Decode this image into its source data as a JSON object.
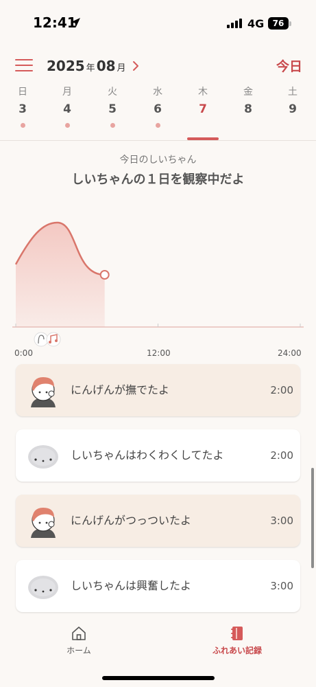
{
  "status_bar": {
    "time": "12:41",
    "network": "4G",
    "battery": "76"
  },
  "header": {
    "year": "2025",
    "year_unit": "年",
    "month": "08",
    "month_unit": "月",
    "today_label": "今日"
  },
  "week": [
    {
      "weekday": "日",
      "date": "3",
      "has_record": true,
      "selected": false
    },
    {
      "weekday": "月",
      "date": "4",
      "has_record": true,
      "selected": false
    },
    {
      "weekday": "火",
      "date": "5",
      "has_record": true,
      "selected": false
    },
    {
      "weekday": "水",
      "date": "6",
      "has_record": true,
      "selected": false
    },
    {
      "weekday": "木",
      "date": "7",
      "has_record": false,
      "selected": true
    },
    {
      "weekday": "金",
      "date": "8",
      "has_record": false,
      "selected": false
    },
    {
      "weekday": "土",
      "date": "9",
      "has_record": false,
      "selected": false
    }
  ],
  "summary": {
    "subtitle": "今日のしいちゃん",
    "title": "しいちゃんの１日を観察中だよ"
  },
  "chart_data": {
    "type": "area",
    "x": [
      0,
      3.5,
      7.5
    ],
    "y": [
      0.6,
      1.0,
      0.5
    ],
    "xlim": [
      0,
      24
    ],
    "x_ticks": [
      "0:00",
      "12:00",
      "24:00"
    ],
    "accent": "#d9766b",
    "fill": "#f3c6c0"
  },
  "events": [
    {
      "text": "にんげんが撫でたよ",
      "time": "2:00",
      "actor": "human"
    },
    {
      "text": "しいちゃんはわくわくしてたよ",
      "time": "2:00",
      "actor": "pet"
    },
    {
      "text": "にんげんがつっついたよ",
      "time": "3:00",
      "actor": "human"
    },
    {
      "text": "しいちゃんは興奮したよ",
      "time": "3:00",
      "actor": "pet"
    }
  ],
  "tabs": [
    {
      "label": "ホーム",
      "icon": "home-icon",
      "active": false
    },
    {
      "label": "ふれあい記録",
      "icon": "notebook-icon",
      "active": true
    }
  ],
  "colors": {
    "accent": "#c8494c",
    "card_tint": "#f7ede4",
    "background": "#fbf8f5"
  }
}
